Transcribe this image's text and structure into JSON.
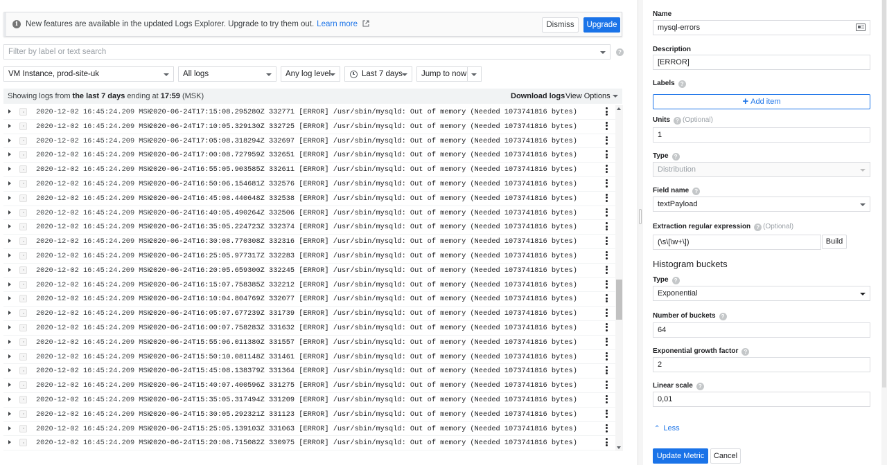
{
  "banner": {
    "message": "New features are available in the updated Logs Explorer. Upgrade to try them out.",
    "learn_more": "Learn more",
    "dismiss": "Dismiss",
    "upgrade": "Upgrade"
  },
  "filter": {
    "placeholder": "Filter by label or text search"
  },
  "toolbar": {
    "resource": "VM Instance, prod-site-uk",
    "logs": "All logs",
    "level": "Any log level",
    "time_range": "Last 7 days",
    "jump": "Jump to now"
  },
  "summary": {
    "prefix": "Showing logs from ",
    "range": "the last 7 days",
    "middle": " ending at ",
    "time": "17:59",
    "zone": " (MSK)",
    "download": "Download logs",
    "view_options": "View Options"
  },
  "log_rows": [
    {
      "ts": "2020-12-02 16:45:24.209 MSK",
      "text": "2020-06-24T17:15:08.295280Z 332771 [ERROR] /usr/sbin/mysqld: Out of memory (Needed 1073741816 bytes)"
    },
    {
      "ts": "2020-12-02 16:45:24.209 MSK",
      "text": "2020-06-24T17:10:05.329130Z 332725 [ERROR] /usr/sbin/mysqld: Out of memory (Needed 1073741816 bytes)"
    },
    {
      "ts": "2020-12-02 16:45:24.209 MSK",
      "text": "2020-06-24T17:05:08.318294Z 332697 [ERROR] /usr/sbin/mysqld: Out of memory (Needed 1073741816 bytes)"
    },
    {
      "ts": "2020-12-02 16:45:24.209 MSK",
      "text": "2020-06-24T17:00:08.727959Z 332651 [ERROR] /usr/sbin/mysqld: Out of memory (Needed 1073741816 bytes)"
    },
    {
      "ts": "2020-12-02 16:45:24.209 MSK",
      "text": "2020-06-24T16:55:05.903585Z 332611 [ERROR] /usr/sbin/mysqld: Out of memory (Needed 1073741816 bytes)"
    },
    {
      "ts": "2020-12-02 16:45:24.209 MSK",
      "text": "2020-06-24T16:50:06.154681Z 332576 [ERROR] /usr/sbin/mysqld: Out of memory (Needed 1073741816 bytes)"
    },
    {
      "ts": "2020-12-02 16:45:24.209 MSK",
      "text": "2020-06-24T16:45:08.440648Z 332538 [ERROR] /usr/sbin/mysqld: Out of memory (Needed 1073741816 bytes)"
    },
    {
      "ts": "2020-12-02 16:45:24.209 MSK",
      "text": "2020-06-24T16:40:05.490264Z 332506 [ERROR] /usr/sbin/mysqld: Out of memory (Needed 1073741816 bytes)"
    },
    {
      "ts": "2020-12-02 16:45:24.209 MSK",
      "text": "2020-06-24T16:35:05.224723Z 332374 [ERROR] /usr/sbin/mysqld: Out of memory (Needed 1073741816 bytes)"
    },
    {
      "ts": "2020-12-02 16:45:24.209 MSK",
      "text": "2020-06-24T16:30:08.770308Z 332316 [ERROR] /usr/sbin/mysqld: Out of memory (Needed 1073741816 bytes)"
    },
    {
      "ts": "2020-12-02 16:45:24.209 MSK",
      "text": "2020-06-24T16:25:05.977317Z 332283 [ERROR] /usr/sbin/mysqld: Out of memory (Needed 1073741816 bytes)"
    },
    {
      "ts": "2020-12-02 16:45:24.209 MSK",
      "text": "2020-06-24T16:20:05.659300Z 332245 [ERROR] /usr/sbin/mysqld: Out of memory (Needed 1073741816 bytes)"
    },
    {
      "ts": "2020-12-02 16:45:24.209 MSK",
      "text": "2020-06-24T16:15:07.758385Z 332212 [ERROR] /usr/sbin/mysqld: Out of memory (Needed 1073741816 bytes)"
    },
    {
      "ts": "2020-12-02 16:45:24.209 MSK",
      "text": "2020-06-24T16:10:04.804769Z 332077 [ERROR] /usr/sbin/mysqld: Out of memory (Needed 1073741816 bytes)"
    },
    {
      "ts": "2020-12-02 16:45:24.209 MSK",
      "text": "2020-06-24T16:05:07.677239Z 331739 [ERROR] /usr/sbin/mysqld: Out of memory (Needed 1073741816 bytes)"
    },
    {
      "ts": "2020-12-02 16:45:24.209 MSK",
      "text": "2020-06-24T16:00:07.758283Z 331632 [ERROR] /usr/sbin/mysqld: Out of memory (Needed 1073741816 bytes)"
    },
    {
      "ts": "2020-12-02 16:45:24.209 MSK",
      "text": "2020-06-24T15:55:06.011380Z 331557 [ERROR] /usr/sbin/mysqld: Out of memory (Needed 1073741816 bytes)"
    },
    {
      "ts": "2020-12-02 16:45:24.209 MSK",
      "text": "2020-06-24T15:50:10.081148Z 331461 [ERROR] /usr/sbin/mysqld: Out of memory (Needed 1073741816 bytes)"
    },
    {
      "ts": "2020-12-02 16:45:24.209 MSK",
      "text": "2020-06-24T15:45:08.138379Z 331364 [ERROR] /usr/sbin/mysqld: Out of memory (Needed 1073741816 bytes)"
    },
    {
      "ts": "2020-12-02 16:45:24.209 MSK",
      "text": "2020-06-24T15:40:07.400596Z 331275 [ERROR] /usr/sbin/mysqld: Out of memory (Needed 1073741816 bytes)"
    },
    {
      "ts": "2020-12-02 16:45:24.209 MSK",
      "text": "2020-06-24T15:35:05.317494Z 331209 [ERROR] /usr/sbin/mysqld: Out of memory (Needed 1073741816 bytes)"
    },
    {
      "ts": "2020-12-02 16:45:24.209 MSK",
      "text": "2020-06-24T15:30:05.292321Z 331123 [ERROR] /usr/sbin/mysqld: Out of memory (Needed 1073741816 bytes)"
    },
    {
      "ts": "2020-12-02 16:45:24.209 MSK",
      "text": "2020-06-24T15:25:05.139103Z 331063 [ERROR] /usr/sbin/mysqld: Out of memory (Needed 1073741816 bytes)"
    },
    {
      "ts": "2020-12-02 16:45:24.209 MSK",
      "text": "2020-06-24T15:20:08.715082Z 330975 [ERROR] /usr/sbin/mysqld: Out of memory (Needed 1073741816 bytes)"
    }
  ],
  "metric_form": {
    "name_label": "Name",
    "name_value": "mysql-errors",
    "description_label": "Description",
    "description_value": "[ERROR]",
    "labels_label": "Labels",
    "add_item": "Add item",
    "units_label": "Units",
    "units_optional": "(Optional)",
    "units_value": "1",
    "type_label": "Type",
    "type_value": "Distribution",
    "field_name_label": "Field name",
    "field_name_value": "textPayload",
    "regex_label": "Extraction regular expression",
    "regex_optional": "(Optional)",
    "regex_value": "(\\s\\[\\w+\\])",
    "build": "Build",
    "histogram_title": "Histogram buckets",
    "bucket_type_label": "Type",
    "bucket_type_value": "Exponential",
    "num_buckets_label": "Number of buckets",
    "num_buckets_value": "64",
    "growth_label": "Exponential growth factor",
    "growth_value": "2",
    "scale_label": "Linear scale",
    "scale_value": "0,01",
    "less": "Less",
    "update": "Update Metric",
    "cancel": "Cancel"
  }
}
